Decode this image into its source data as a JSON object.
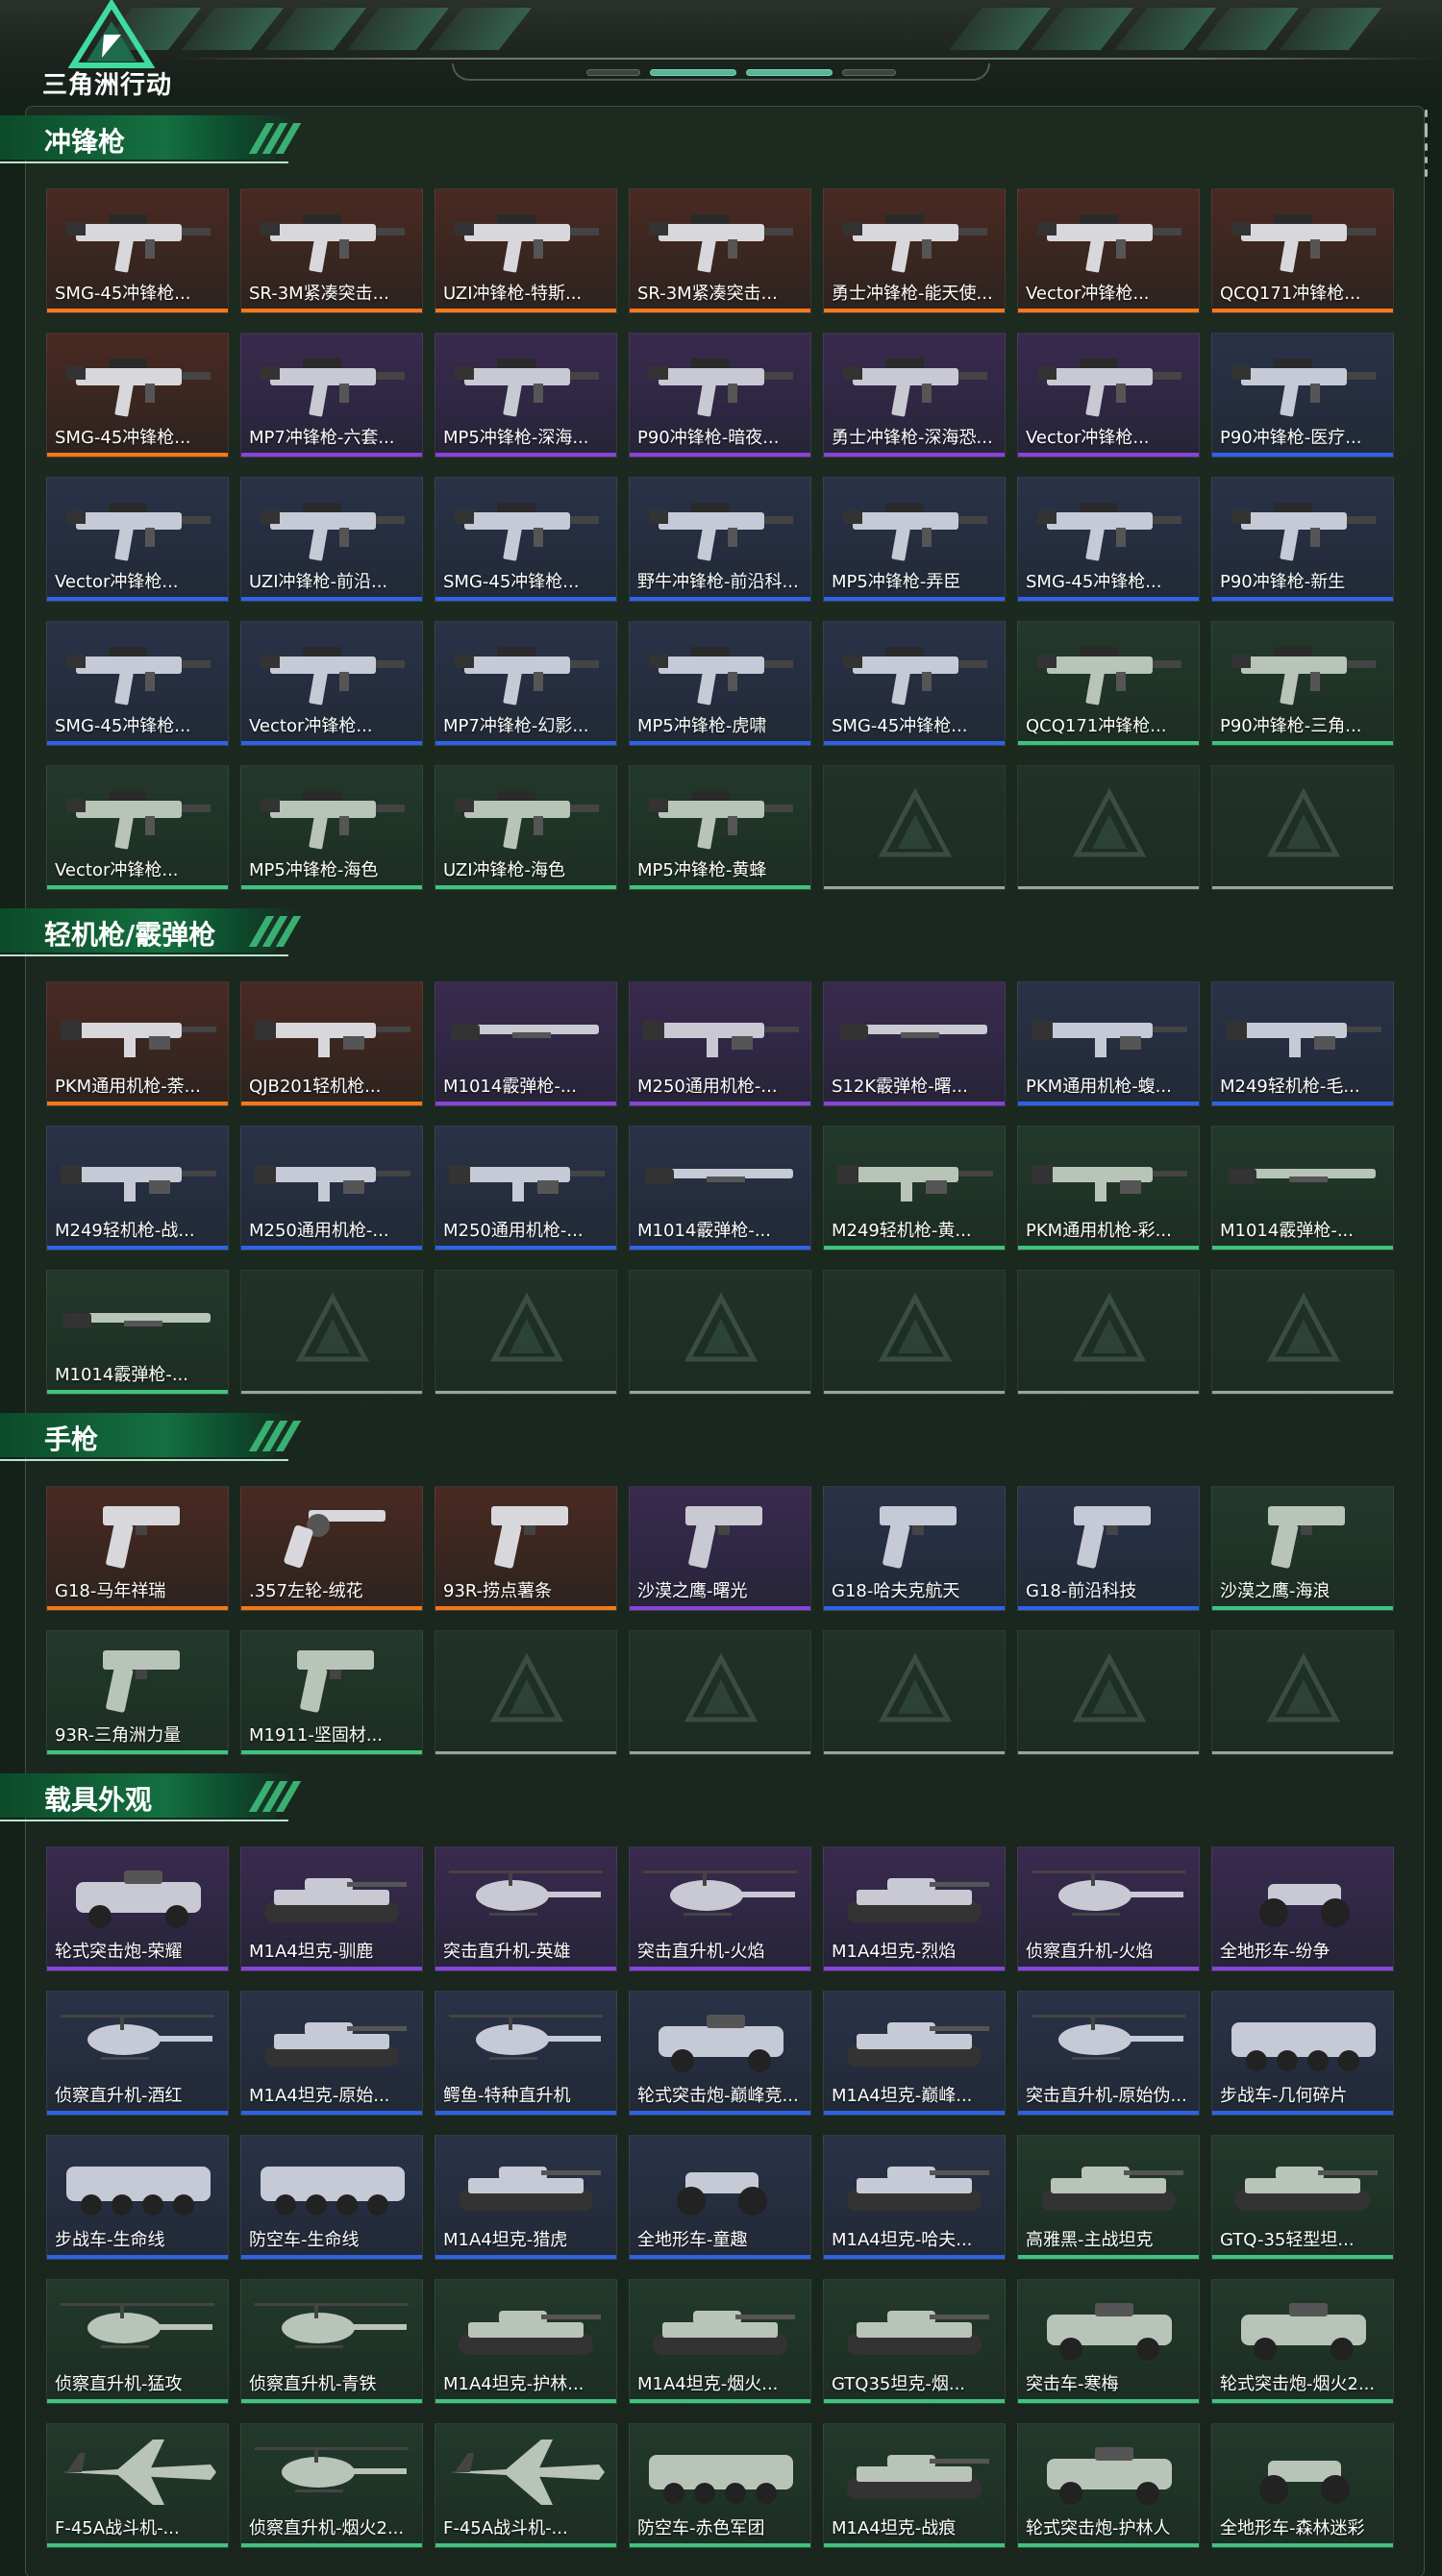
{
  "header": {
    "logo_text": "三角洲行动",
    "nav_pills": [
      {
        "active": false
      },
      {
        "active": true
      },
      {
        "active": true
      },
      {
        "active": false
      }
    ]
  },
  "colors": {
    "orange": "#f07a18",
    "purple": "#8744d8",
    "blue": "#2d63e4",
    "green": "#3fc47d",
    "accent": "#147040"
  },
  "sections": [
    {
      "title": "冲锋枪",
      "items": [
        {
          "label": "SMG-45冲锋枪...",
          "rarity": "orange",
          "icon": "smg-icon"
        },
        {
          "label": "SR-3M紧凑突击...",
          "rarity": "orange",
          "icon": "smg-icon"
        },
        {
          "label": "UZI冲锋枪-特斯...",
          "rarity": "orange",
          "icon": "smg-icon"
        },
        {
          "label": "SR-3M紧凑突击...",
          "rarity": "orange",
          "icon": "smg-icon"
        },
        {
          "label": "勇士冲锋枪-能天使...",
          "rarity": "orange",
          "icon": "smg-icon"
        },
        {
          "label": "Vector冲锋枪...",
          "rarity": "orange",
          "icon": "smg-icon"
        },
        {
          "label": "QCQ171冲锋枪...",
          "rarity": "orange",
          "icon": "smg-icon"
        },
        {
          "label": "SMG-45冲锋枪...",
          "rarity": "orange",
          "icon": "smg-icon"
        },
        {
          "label": "MP7冲锋枪-六套...",
          "rarity": "purple",
          "icon": "smg-icon"
        },
        {
          "label": "MP5冲锋枪-深海...",
          "rarity": "purple",
          "icon": "smg-icon"
        },
        {
          "label": "P90冲锋枪-暗夜...",
          "rarity": "purple",
          "icon": "smg-icon"
        },
        {
          "label": "勇士冲锋枪-深海恐...",
          "rarity": "purple",
          "icon": "smg-icon"
        },
        {
          "label": "Vector冲锋枪...",
          "rarity": "purple",
          "icon": "smg-icon"
        },
        {
          "label": "P90冲锋枪-医疗...",
          "rarity": "blue",
          "icon": "smg-icon"
        },
        {
          "label": "Vector冲锋枪...",
          "rarity": "blue",
          "icon": "smg-icon"
        },
        {
          "label": "UZI冲锋枪-前沿...",
          "rarity": "blue",
          "icon": "smg-icon"
        },
        {
          "label": "SMG-45冲锋枪...",
          "rarity": "blue",
          "icon": "smg-icon"
        },
        {
          "label": "野牛冲锋枪-前沿科...",
          "rarity": "blue",
          "icon": "smg-icon"
        },
        {
          "label": "MP5冲锋枪-弄臣",
          "rarity": "blue",
          "icon": "smg-icon"
        },
        {
          "label": "SMG-45冲锋枪...",
          "rarity": "blue",
          "icon": "smg-icon"
        },
        {
          "label": "P90冲锋枪-新生",
          "rarity": "blue",
          "icon": "smg-icon"
        },
        {
          "label": "SMG-45冲锋枪...",
          "rarity": "blue",
          "icon": "smg-icon"
        },
        {
          "label": "Vector冲锋枪...",
          "rarity": "blue",
          "icon": "smg-icon"
        },
        {
          "label": "MP7冲锋枪-幻影...",
          "rarity": "blue",
          "icon": "smg-icon"
        },
        {
          "label": "MP5冲锋枪-虎啸",
          "rarity": "blue",
          "icon": "smg-icon"
        },
        {
          "label": "SMG-45冲锋枪...",
          "rarity": "blue",
          "icon": "smg-icon"
        },
        {
          "label": "QCQ171冲锋枪...",
          "rarity": "green",
          "icon": "smg-icon"
        },
        {
          "label": "P90冲锋枪-三角...",
          "rarity": "green",
          "icon": "smg-icon"
        },
        {
          "label": "Vector冲锋枪...",
          "rarity": "green",
          "icon": "smg-icon"
        },
        {
          "label": "MP5冲锋枪-海色",
          "rarity": "green",
          "icon": "smg-icon"
        },
        {
          "label": "UZI冲锋枪-海色",
          "rarity": "green",
          "icon": "smg-icon"
        },
        {
          "label": "MP5冲锋枪-黄蜂",
          "rarity": "green",
          "icon": "smg-icon"
        }
      ],
      "empty_slots": 3
    },
    {
      "title": "轻机枪/霰弹枪",
      "items": [
        {
          "label": "PKM通用机枪-荼...",
          "rarity": "orange",
          "icon": "lmg-icon"
        },
        {
          "label": "QJB201轻机枪...",
          "rarity": "orange",
          "icon": "lmg-icon"
        },
        {
          "label": "M1014霰弹枪-...",
          "rarity": "purple",
          "icon": "shotgun-icon"
        },
        {
          "label": "M250通用机枪-...",
          "rarity": "purple",
          "icon": "lmg-icon"
        },
        {
          "label": "S12K霰弹枪-曙...",
          "rarity": "purple",
          "icon": "shotgun-icon"
        },
        {
          "label": "PKM通用机枪-蝮...",
          "rarity": "blue",
          "icon": "lmg-icon"
        },
        {
          "label": "M249轻机枪-毛...",
          "rarity": "blue",
          "icon": "lmg-icon"
        },
        {
          "label": "M249轻机枪-战...",
          "rarity": "blue",
          "icon": "lmg-icon"
        },
        {
          "label": "M250通用机枪-...",
          "rarity": "blue",
          "icon": "lmg-icon"
        },
        {
          "label": "M250通用机枪-...",
          "rarity": "blue",
          "icon": "lmg-icon"
        },
        {
          "label": "M1014霰弹枪-...",
          "rarity": "blue",
          "icon": "shotgun-icon"
        },
        {
          "label": "M249轻机枪-黄...",
          "rarity": "green",
          "icon": "lmg-icon"
        },
        {
          "label": "PKM通用机枪-彩...",
          "rarity": "green",
          "icon": "lmg-icon"
        },
        {
          "label": "M1014霰弹枪-...",
          "rarity": "green",
          "icon": "shotgun-icon"
        },
        {
          "label": "M1014霰弹枪-...",
          "rarity": "green",
          "icon": "shotgun-icon"
        }
      ],
      "empty_slots": 6
    },
    {
      "title": "手枪",
      "items": [
        {
          "label": "G18-马年祥瑞",
          "rarity": "orange",
          "icon": "pistol-icon"
        },
        {
          "label": ".357左轮-绒花",
          "rarity": "orange",
          "icon": "revolver-icon"
        },
        {
          "label": "93R-捞点薯条",
          "rarity": "orange",
          "icon": "pistol-icon"
        },
        {
          "label": "沙漠之鹰-曙光",
          "rarity": "purple",
          "icon": "pistol-icon"
        },
        {
          "label": "G18-哈夫克航天",
          "rarity": "blue",
          "icon": "pistol-icon"
        },
        {
          "label": "G18-前沿科技",
          "rarity": "blue",
          "icon": "pistol-icon"
        },
        {
          "label": "沙漠之鹰-海浪",
          "rarity": "green",
          "icon": "pistol-icon"
        },
        {
          "label": "93R-三角洲力量",
          "rarity": "green",
          "icon": "pistol-icon"
        },
        {
          "label": "M1911-坚固材...",
          "rarity": "green",
          "icon": "pistol-icon"
        }
      ],
      "empty_slots": 5
    },
    {
      "title": "载具外观",
      "items": [
        {
          "label": "轮式突击炮-荣耀",
          "rarity": "purple",
          "icon": "armored-car-icon"
        },
        {
          "label": "M1A4坦克-驯鹿",
          "rarity": "purple",
          "icon": "tank-icon"
        },
        {
          "label": "突击直升机-英雄",
          "rarity": "purple",
          "icon": "helicopter-icon"
        },
        {
          "label": "突击直升机-火焰",
          "rarity": "purple",
          "icon": "helicopter-icon"
        },
        {
          "label": "M1A4坦克-烈焰",
          "rarity": "purple",
          "icon": "tank-icon"
        },
        {
          "label": "侦察直升机-火焰",
          "rarity": "purple",
          "icon": "helicopter-icon"
        },
        {
          "label": "全地形车-纷争",
          "rarity": "purple",
          "icon": "atv-icon"
        },
        {
          "label": "侦察直升机-酒红",
          "rarity": "blue",
          "icon": "helicopter-icon"
        },
        {
          "label": "M1A4坦克-原始...",
          "rarity": "blue",
          "icon": "tank-icon"
        },
        {
          "label": "鳄鱼-特种直升机",
          "rarity": "blue",
          "icon": "helicopter-icon"
        },
        {
          "label": "轮式突击炮-巅峰竞...",
          "rarity": "blue",
          "icon": "armored-car-icon"
        },
        {
          "label": "M1A4坦克-巅峰...",
          "rarity": "blue",
          "icon": "tank-icon"
        },
        {
          "label": "突击直升机-原始伪...",
          "rarity": "blue",
          "icon": "helicopter-icon"
        },
        {
          "label": "步战车-几何碎片",
          "rarity": "blue",
          "icon": "ifv-icon"
        },
        {
          "label": "步战车-生命线",
          "rarity": "blue",
          "icon": "ifv-icon"
        },
        {
          "label": "防空车-生命线",
          "rarity": "blue",
          "icon": "ifv-icon"
        },
        {
          "label": "M1A4坦克-猎虎",
          "rarity": "blue",
          "icon": "tank-icon"
        },
        {
          "label": "全地形车-童趣",
          "rarity": "blue",
          "icon": "atv-icon"
        },
        {
          "label": "M1A4坦克-哈夫...",
          "rarity": "blue",
          "icon": "tank-icon"
        },
        {
          "label": "高雅黑-主战坦克",
          "rarity": "green",
          "icon": "tank-icon"
        },
        {
          "label": "GTQ-35轻型坦...",
          "rarity": "green",
          "icon": "tank-icon"
        },
        {
          "label": "侦察直升机-猛攻",
          "rarity": "green",
          "icon": "helicopter-icon"
        },
        {
          "label": "侦察直升机-青铁",
          "rarity": "green",
          "icon": "helicopter-icon"
        },
        {
          "label": "M1A4坦克-护林...",
          "rarity": "green",
          "icon": "tank-icon"
        },
        {
          "label": "M1A4坦克-烟火...",
          "rarity": "green",
          "icon": "tank-icon"
        },
        {
          "label": "GTQ35坦克-烟...",
          "rarity": "green",
          "icon": "tank-icon"
        },
        {
          "label": "突击车-寒梅",
          "rarity": "green",
          "icon": "armored-car-icon"
        },
        {
          "label": "轮式突击炮-烟火2...",
          "rarity": "green",
          "icon": "armored-car-icon"
        },
        {
          "label": "F-45A战斗机-...",
          "rarity": "green",
          "icon": "jet-icon"
        },
        {
          "label": "侦察直升机-烟火2...",
          "rarity": "green",
          "icon": "helicopter-icon"
        },
        {
          "label": "F-45A战斗机-...",
          "rarity": "green",
          "icon": "jet-icon"
        },
        {
          "label": "防空车-赤色军团",
          "rarity": "green",
          "icon": "ifv-icon"
        },
        {
          "label": "M1A4坦克-战痕",
          "rarity": "green",
          "icon": "tank-icon"
        },
        {
          "label": "轮式突击炮-护林人",
          "rarity": "green",
          "icon": "armored-car-icon"
        },
        {
          "label": "全地形车-森林迷彩",
          "rarity": "green",
          "icon": "atv-icon"
        }
      ],
      "empty_slots": 0
    }
  ]
}
